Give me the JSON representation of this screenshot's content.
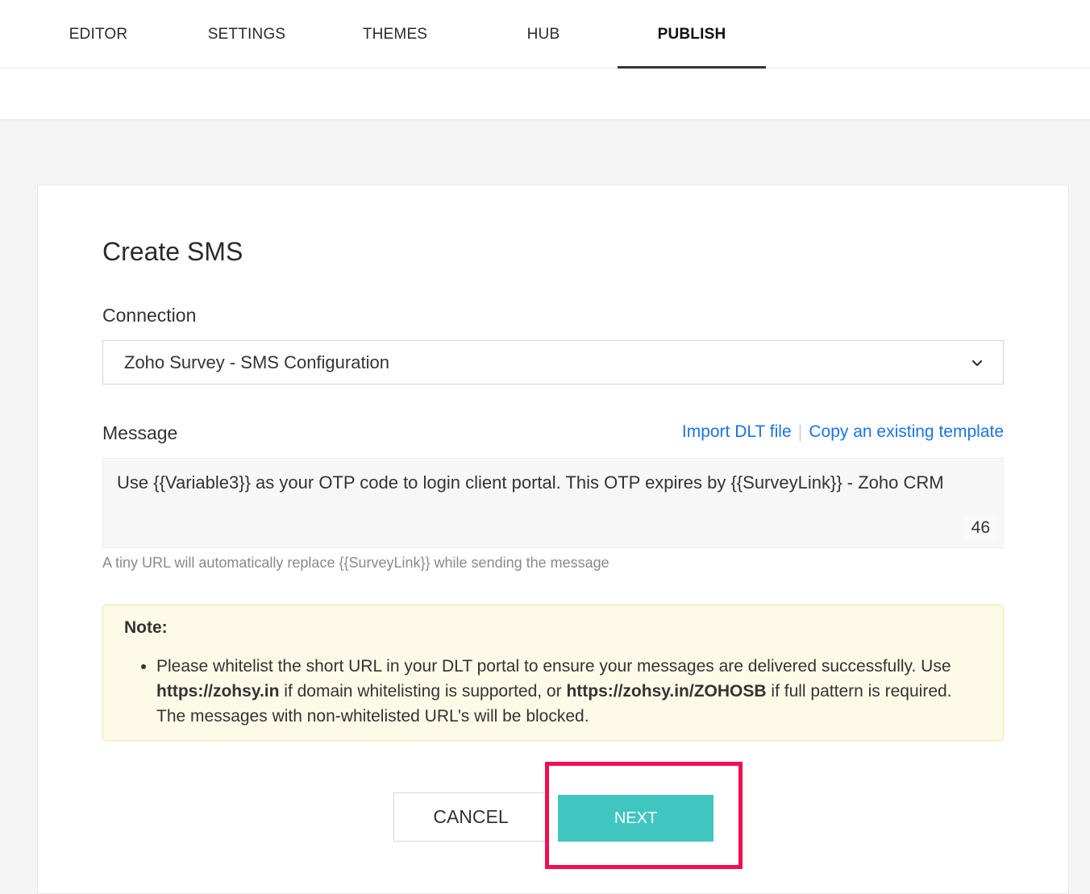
{
  "tabs": [
    {
      "label": "EDITOR"
    },
    {
      "label": "SETTINGS"
    },
    {
      "label": "THEMES"
    },
    {
      "label": "HUB"
    },
    {
      "label": "PUBLISH",
      "active": true
    }
  ],
  "form": {
    "title": "Create SMS",
    "connection_label": "Connection",
    "connection_value": "Zoho Survey - SMS Configuration",
    "message_label": "Message",
    "import_link": "Import DLT file",
    "copy_link": "Copy an existing template",
    "message_text": "Use {{Variable3}} as your OTP code to login client portal. This OTP expires by {{SurveyLink}} - Zoho CRM",
    "char_count": "46",
    "hint": "A tiny URL will automatically replace {{SurveyLink}} while sending the message"
  },
  "note": {
    "title": "Note:",
    "text_1": "Please whitelist the short URL in your DLT portal to ensure your messages are delivered successfully. Use ",
    "url_1": "https://zohsy.in",
    "text_2": " if domain whitelisting is supported, or ",
    "url_2": "https://zohsy.in/ZOHOSB",
    "text_3": " if full pattern is required. The messages with non-whitelisted URL’s will be blocked."
  },
  "buttons": {
    "cancel": "CANCEL",
    "next": "NEXT"
  },
  "colors": {
    "accent": "#41c5c0",
    "link": "#1a73e8",
    "highlight": "#f0104f",
    "note_bg": "#fdfae8"
  }
}
